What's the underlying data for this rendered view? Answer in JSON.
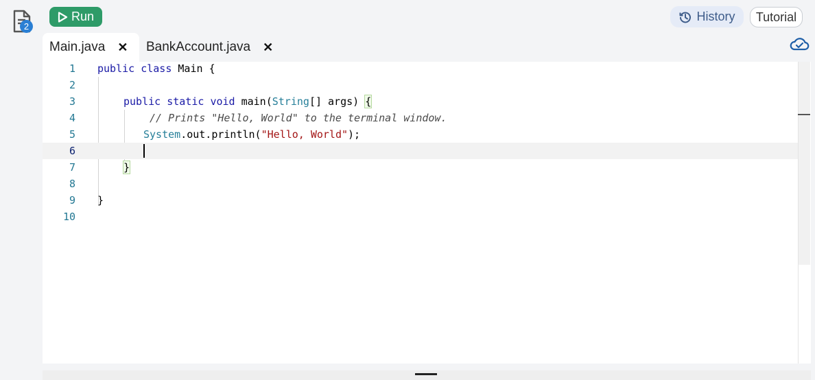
{
  "sidebar": {
    "files_badge": "2"
  },
  "toolbar": {
    "run_label": "Run",
    "history_label": "History",
    "tutorial_label": "Tutorial"
  },
  "tabs": [
    {
      "label": "Main.java",
      "close": "✕",
      "active": true
    },
    {
      "label": "BankAccount.java",
      "close": "✕",
      "active": false
    }
  ],
  "editor": {
    "current_line": 6,
    "lines": [
      {
        "n": "1",
        "text": "public class Main {"
      },
      {
        "n": "2",
        "text": ""
      },
      {
        "n": "3",
        "text": "public static void main(String[] args) {"
      },
      {
        "n": "4",
        "text": "// Prints \"Hello, World\" to the terminal window."
      },
      {
        "n": "5",
        "text": "System.out.println(\"Hello, World\");"
      },
      {
        "n": "6",
        "text": ""
      },
      {
        "n": "7",
        "text": "}"
      },
      {
        "n": "8",
        "text": ""
      },
      {
        "n": "9",
        "text": "}"
      },
      {
        "n": "10",
        "text": ""
      }
    ]
  },
  "colors": {
    "run": "#2e9b68",
    "badge": "#2a7fd4",
    "history_bg": "#e5ebf7"
  }
}
